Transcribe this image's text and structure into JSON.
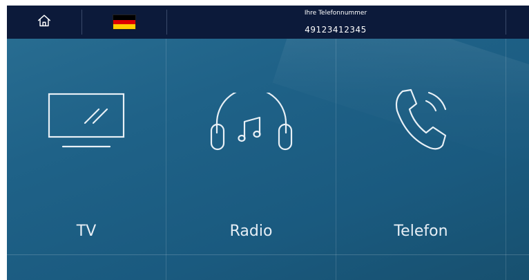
{
  "topbar": {
    "home_icon": "home-icon",
    "language_flag": "germany-flag",
    "flag_colors": [
      "#000000",
      "#dd0000",
      "#ffce00"
    ],
    "phone_label": "Ihre Telefonnummer",
    "phone_number": "49123412345"
  },
  "tiles": [
    {
      "label": "TV",
      "icon": "tv-icon"
    },
    {
      "label": "Radio",
      "icon": "headphones-icon"
    },
    {
      "label": "Telefon",
      "icon": "phone-icon"
    }
  ],
  "colors": {
    "topbar_bg": "#0c1a3a",
    "background": "#1f6288",
    "text": "#e6eef5"
  }
}
